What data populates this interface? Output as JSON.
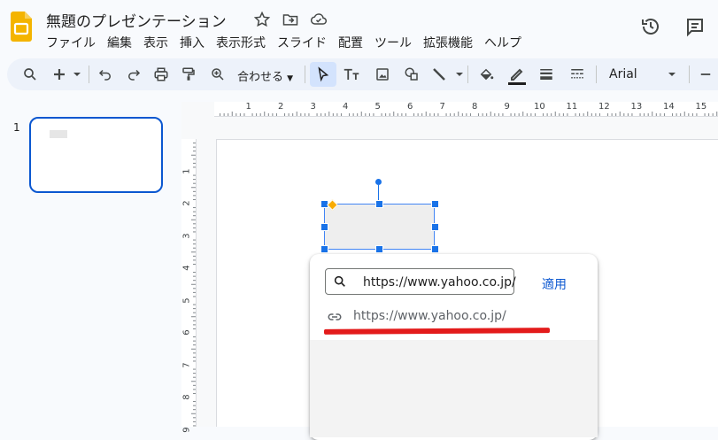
{
  "app": {
    "doc_title": "無題のプレゼンテーション",
    "menu": [
      "ファイル",
      "編集",
      "表示",
      "挿入",
      "表示形式",
      "スライド",
      "配置",
      "ツール",
      "拡張機能",
      "ヘルプ"
    ]
  },
  "toolbar": {
    "zoom_label": "合わせる",
    "font": "Arial",
    "icons": [
      "search-icon",
      "add-icon",
      "undo-icon",
      "redo-icon",
      "print-icon",
      "paint-format-icon",
      "zoom-icon",
      "select-icon",
      "text-box-icon",
      "image-icon",
      "shape-icon",
      "line-icon",
      "fill-color-icon",
      "border-color-icon",
      "border-weight-icon",
      "border-dash-icon",
      "font-size-decrease-icon"
    ]
  },
  "slides_panel": {
    "slide_number": "1"
  },
  "ruler": {
    "top_numbers": [
      "1",
      "2",
      "3",
      "4",
      "5",
      "6",
      "7",
      "8",
      "9",
      "10",
      "11",
      "12",
      "13",
      "14",
      "15"
    ],
    "left_numbers": [
      "1",
      "2",
      "3",
      "4",
      "5",
      "6",
      "7",
      "8",
      "9"
    ]
  },
  "link_popup": {
    "input_value": "https://www.yahoo.co.jp/",
    "apply_label": "適用",
    "suggestion": "https://www.yahoo.co.jp/"
  },
  "colors": {
    "accent": "#0b57d0",
    "selection": "#1a73e8",
    "annotation_underline": "#e31b1b"
  }
}
